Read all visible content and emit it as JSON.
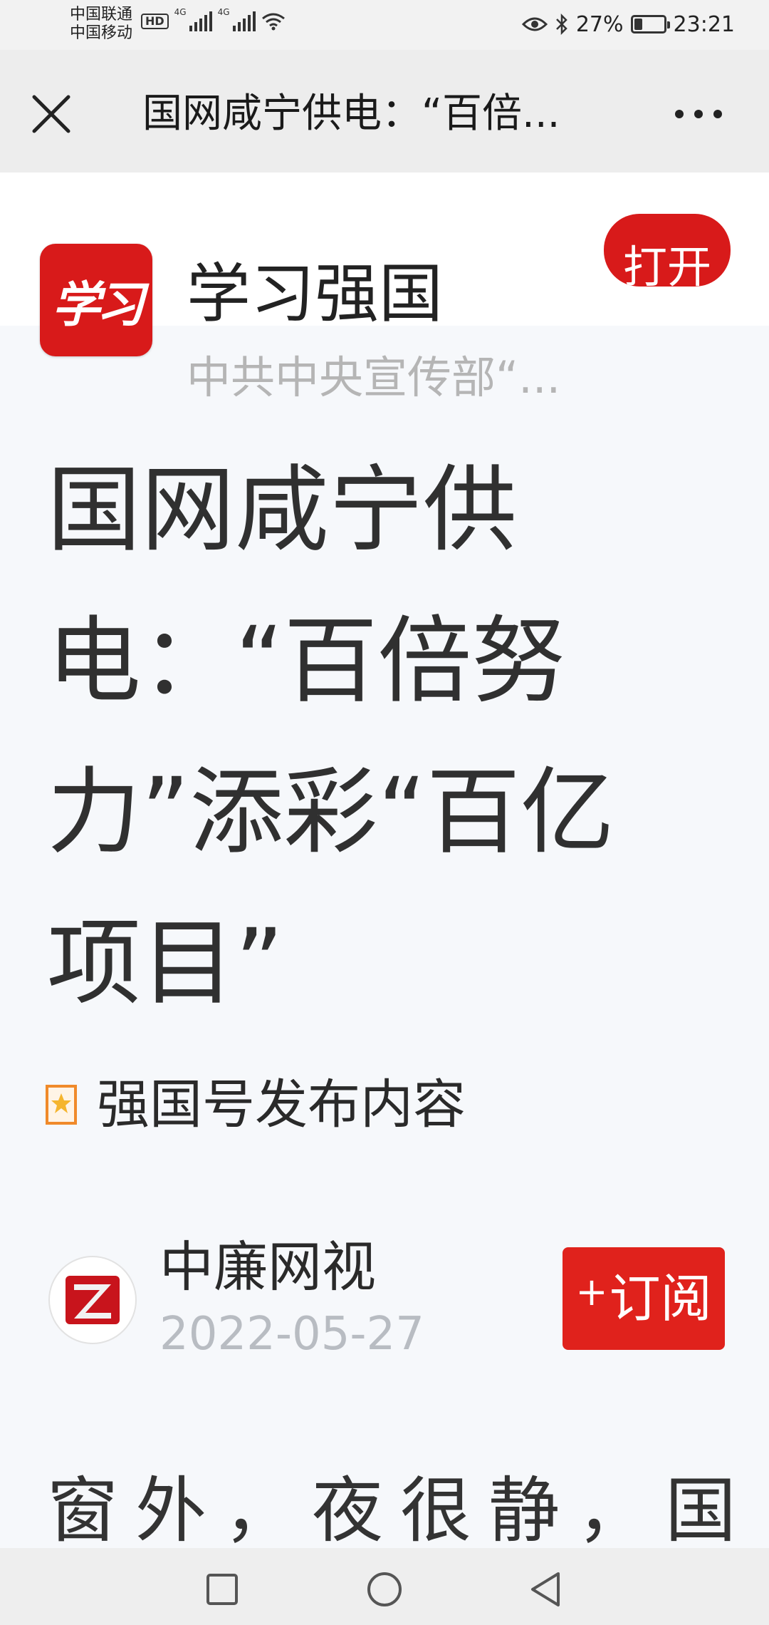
{
  "status_bar": {
    "carrier_1": "中国联通",
    "carrier_2": "中国移动",
    "hd_label": "HD",
    "network_1": "4G",
    "network_2": "4G",
    "battery_text": "27%",
    "battery_level": 0.27,
    "time": "23:21",
    "icons": [
      "signal-icon",
      "wifi-icon",
      "eye-icon",
      "bluetooth-icon",
      "battery-icon"
    ]
  },
  "nav": {
    "title": "国网咸宁供电：“百倍...",
    "close_icon": "close-icon",
    "more_icon": "more-icon"
  },
  "app_banner": {
    "logo_text": "学习",
    "app_name": "学习强国",
    "description": "中共中央宣传部“...",
    "open_label": "打开"
  },
  "article": {
    "title": "国网咸宁供电：“百倍努力”添彩“百亿项目”",
    "source_label": "强国号发布内容",
    "author": "中廉网视",
    "date": "2022-05-27",
    "subscribe_label": "订阅",
    "subscribe_plus": "+",
    "body_start": "窗外，夜很静，国"
  },
  "colors": {
    "brand_red": "#d81a1a",
    "subscribe_red": "#e0221c",
    "badge_orange": "#f08a2a",
    "muted_gray": "#b5b5b5"
  }
}
